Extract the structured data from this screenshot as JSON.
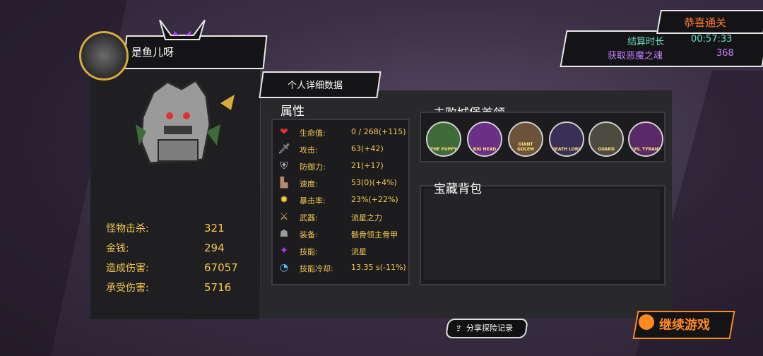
{
  "player": {
    "name": "是鱼儿呀"
  },
  "kill_stats": [
    {
      "label": "怪物击杀:",
      "value": "321"
    },
    {
      "label": "金钱:",
      "value": "294"
    },
    {
      "label": "造成伤害:",
      "value": "67057"
    },
    {
      "label": "承受伤害:",
      "value": "5716"
    }
  ],
  "detail_tab": {
    "label": "个人详细数据"
  },
  "attributes": {
    "title": "属性",
    "rows": [
      {
        "icon": "heart-icon",
        "label": "生命值:",
        "value": "0 / 268(+115)"
      },
      {
        "icon": "sword-icon",
        "label": "攻击:",
        "value": "63(+42)"
      },
      {
        "icon": "shield-icon",
        "label": "防御力:",
        "value": "21(+17)"
      },
      {
        "icon": "boot-icon",
        "label": "速度:",
        "value": "53(0)(+4%)"
      },
      {
        "icon": "sun-burst-icon",
        "label": "暴击率:",
        "value": "23%(+22%)"
      },
      {
        "icon": "weapon-icon",
        "label": "武器:",
        "value": "流星之力"
      },
      {
        "icon": "armor-icon",
        "label": "装备:",
        "value": "骸骨领主骨甲"
      },
      {
        "icon": "skill-icon",
        "label": "技能:",
        "value": "流星"
      },
      {
        "icon": "cooldown-icon",
        "label": "技能冷却:",
        "value": "13.35 s(-11%)"
      }
    ]
  },
  "bosses": {
    "title": "击败城堡首领",
    "items": [
      {
        "name": "THE PUPPY",
        "color": "#3f6b3a"
      },
      {
        "name": "BIG HEAD",
        "color": "#6a2f86"
      },
      {
        "name": "GIANT GOLEM",
        "color": "#6b5238"
      },
      {
        "name": "DEATH LORD",
        "color": "#3a2f55"
      },
      {
        "name": "GUARD",
        "color": "#4d4a40"
      },
      {
        "name": "EVIL TYRANT",
        "color": "#5a2a66"
      }
    ]
  },
  "treasure": {
    "title": "宝藏背包"
  },
  "result": {
    "title": "恭喜通关",
    "rows": [
      {
        "label": "结算时长",
        "value": "00:57:33",
        "color": "#66e0c8"
      },
      {
        "label": "获取恶魔之魂",
        "value": "368",
        "color": "#c77dff"
      }
    ]
  },
  "buttons": {
    "share": "分享探险记录",
    "continue": "继续游戏"
  },
  "colors": {
    "accent_gold": "#f4c74a",
    "accent_orange": "#ff8a1f",
    "accent_teal": "#66e0c8",
    "accent_purple": "#c77dff"
  }
}
